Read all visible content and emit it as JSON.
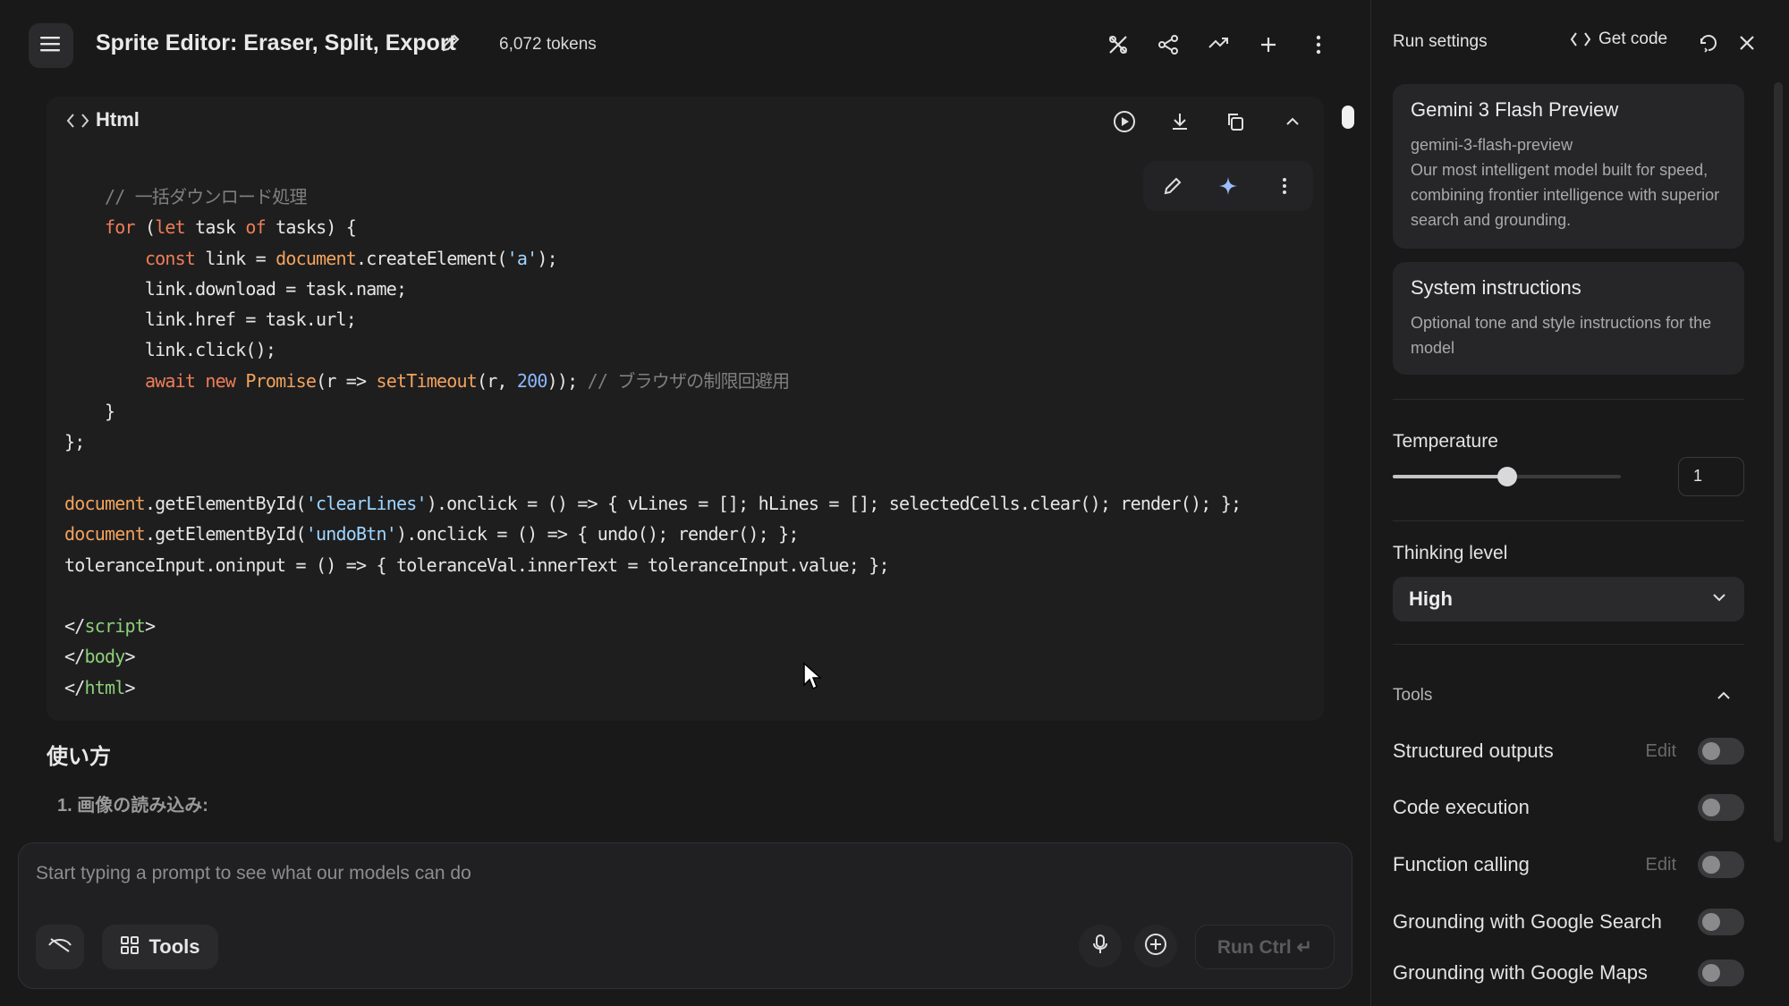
{
  "header": {
    "title": "Sprite Editor: Eraser, Split, Export",
    "tokens": "6,072 tokens"
  },
  "code_block": {
    "language_label": "Html",
    "lines": [
      [
        {
          "t": "    "
        },
        {
          "t": "// 一括ダウンロード処理",
          "c": "c"
        }
      ],
      [
        {
          "t": "    "
        },
        {
          "t": "for",
          "c": "k"
        },
        {
          "t": " ("
        },
        {
          "t": "let",
          "c": "k"
        },
        {
          "t": " task "
        },
        {
          "t": "of",
          "c": "k"
        },
        {
          "t": " tasks) {"
        }
      ],
      [
        {
          "t": "        "
        },
        {
          "t": "const",
          "c": "k"
        },
        {
          "t": " link = "
        },
        {
          "t": "document",
          "c": "f"
        },
        {
          "t": ".createElement("
        },
        {
          "t": "'a'",
          "c": "s"
        },
        {
          "t": ");"
        }
      ],
      [
        {
          "t": "        link.download = task.name;"
        }
      ],
      [
        {
          "t": "        link.href = task.url;"
        }
      ],
      [
        {
          "t": "        link.click();"
        }
      ],
      [
        {
          "t": "        "
        },
        {
          "t": "await",
          "c": "k"
        },
        {
          "t": " "
        },
        {
          "t": "new",
          "c": "k"
        },
        {
          "t": " "
        },
        {
          "t": "Promise",
          "c": "f"
        },
        {
          "t": "(r => "
        },
        {
          "t": "setTimeout",
          "c": "f"
        },
        {
          "t": "(r, "
        },
        {
          "t": "200",
          "c": "n"
        },
        {
          "t": ")); "
        },
        {
          "t": "// ブラウザの制限回避用",
          "c": "c"
        }
      ],
      [
        {
          "t": "    }"
        }
      ],
      [
        {
          "t": "};"
        }
      ],
      [
        {
          "t": ""
        }
      ],
      [
        {
          "t": "document",
          "c": "f"
        },
        {
          "t": ".getElementById("
        },
        {
          "t": "'clearLines'",
          "c": "s"
        },
        {
          "t": ").onclick = () => { vLines = []; hLines = []; selectedCells.clear(); render(); };"
        }
      ],
      [
        {
          "t": "document",
          "c": "f"
        },
        {
          "t": ".getElementById("
        },
        {
          "t": "'undoBtn'",
          "c": "s"
        },
        {
          "t": ").onclick = () => { undo(); render(); };"
        }
      ],
      [
        {
          "t": "toleranceInput.oninput = () => { toleranceVal.innerText = toleranceInput.value; };"
        }
      ],
      [
        {
          "t": ""
        }
      ],
      [
        {
          "t": "</"
        },
        {
          "t": "script",
          "c": "t"
        },
        {
          "t": ">"
        }
      ],
      [
        {
          "t": "</"
        },
        {
          "t": "body",
          "c": "t"
        },
        {
          "t": ">"
        }
      ],
      [
        {
          "t": "</"
        },
        {
          "t": "html",
          "c": "t"
        },
        {
          "t": ">"
        }
      ]
    ]
  },
  "content": {
    "heading": "使い方",
    "step1": "1. 画像の読み込み:"
  },
  "prompt": {
    "placeholder": "Start typing a prompt to see what our models can do",
    "tools_label": "Tools",
    "run_label": "Run Ctrl ↵"
  },
  "side": {
    "title": "Run settings",
    "get_code": "Get code",
    "model": {
      "name": "Gemini 3 Flash Preview",
      "id": "gemini-3-flash-preview",
      "description": "Our most intelligent model built for speed, combining frontier intelligence with superior search and grounding."
    },
    "system": {
      "title": "System instructions",
      "description": "Optional tone and style instructions for the model"
    },
    "temperature": {
      "label": "Temperature",
      "value": "1",
      "slider_fraction": 0.5
    },
    "thinking": {
      "label": "Thinking level",
      "value": "High"
    },
    "tools": {
      "label": "Tools",
      "items": [
        {
          "label": "Structured outputs",
          "edit": "Edit",
          "on": false
        },
        {
          "label": "Code execution",
          "edit": "",
          "on": false
        },
        {
          "label": "Function calling",
          "edit": "Edit",
          "on": false
        },
        {
          "label": "Grounding with Google Search",
          "edit": "",
          "on": false
        },
        {
          "label": "Grounding with Google Maps",
          "edit": "",
          "on": false
        }
      ]
    }
  }
}
